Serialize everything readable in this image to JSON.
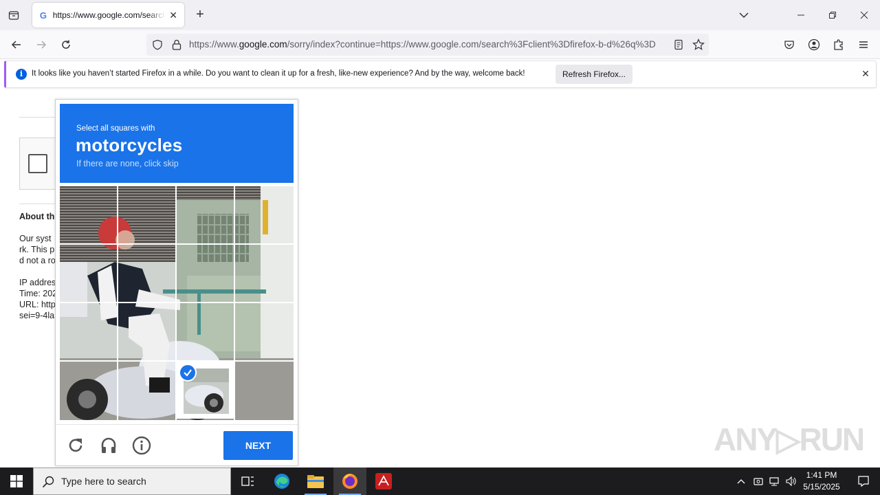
{
  "browser": {
    "tab_title": "https://www.google.com/search?client=firefox-b-d&q",
    "url_prefix": "https://www.",
    "url_domain": "google.com",
    "url_rest": "/sorry/index?continue=https://www.google.com/search%3Fclient%3Dfirefox-b-d%26q%3D",
    "notification_text": "It looks like you haven’t started Firefox in a while. Do you want to clean it up for a fresh, like-new experience? And by the way, welcome back!",
    "notification_button": "Refresh Firefox..."
  },
  "page": {
    "about_heading": "About th",
    "lines": [
      "Our syst",
      "rk. This p",
      "d not a ro",
      "",
      "IP addres",
      "Time: 202",
      "URL: http",
      "sei=9-4la"
    ]
  },
  "captcha": {
    "instruction": "Select all squares with",
    "target": "motorcycles",
    "hint": "If there are none, click skip",
    "next_label": "NEXT",
    "selected_tiles": [
      "row-4-col-3"
    ]
  },
  "watermark": "ANY RUN",
  "taskbar": {
    "search_placeholder": "Type here to search",
    "time": "1:41 PM",
    "date": "5/15/2025"
  }
}
